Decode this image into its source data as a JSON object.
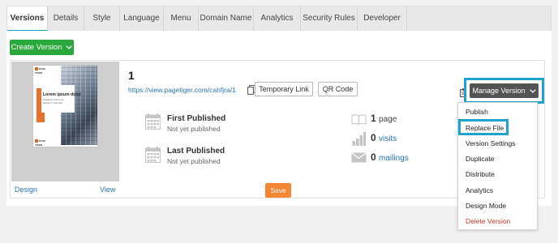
{
  "tabs": [
    {
      "label": "Versions",
      "active": true
    },
    {
      "label": "Details"
    },
    {
      "label": "Style"
    },
    {
      "label": "Language"
    },
    {
      "label": "Menu"
    },
    {
      "label": "Domain Name"
    },
    {
      "label": "Analytics"
    },
    {
      "label": "Security Rules"
    },
    {
      "label": "Developer"
    }
  ],
  "create_version_label": "Create Version",
  "version": {
    "number": "1",
    "url": "https://view.pagetiger.com/cahfjra/1",
    "temporary_link_label": "Temporary Link",
    "qr_code_label": "QR Code",
    "manage_version_label": "Manage Version",
    "design_link": "Design",
    "view_link": "View",
    "thumbnail": {
      "logo_text": "PAGE TIGER",
      "heading": "Lorem ipsum dolor",
      "line1": "Detailed for dreit metus",
      "line2": "Sample 0 / Date 2022"
    },
    "first_published": {
      "title": "First Published",
      "value": "Not yet published"
    },
    "last_published": {
      "title": "Last Published",
      "value": "Not yet published"
    },
    "metrics": {
      "pages": {
        "count": "1",
        "unit": "page"
      },
      "visits": {
        "count": "0",
        "unit": "visits"
      },
      "mailings": {
        "count": "0",
        "unit": "mailings"
      }
    }
  },
  "save_label": "Save",
  "menu": {
    "items": [
      "Publish",
      "Replace File",
      "Version Settings",
      "Duplicate",
      "Distribute",
      "Analytics",
      "Design Mode",
      "Delete Version"
    ]
  },
  "colors": {
    "accent": "#1ea3cf",
    "green": "#2aa83b",
    "orange": "#f58634",
    "link": "#2a73b8",
    "danger": "#c0392b"
  }
}
